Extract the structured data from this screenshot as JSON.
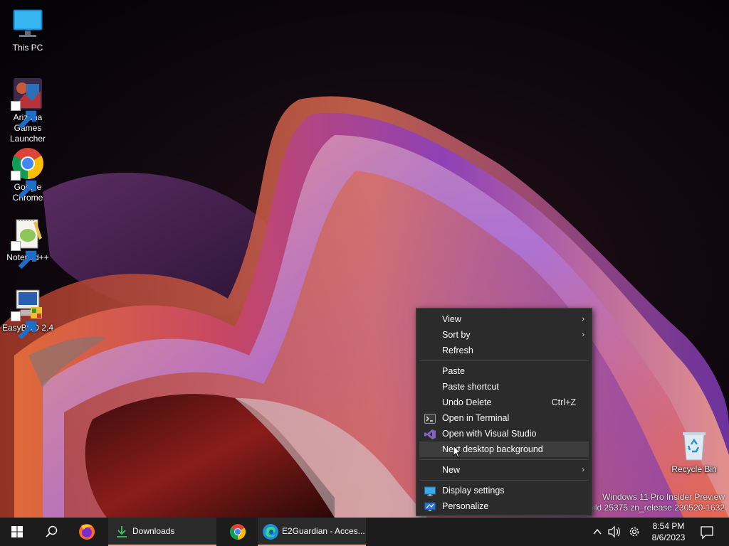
{
  "desktop": {
    "icons": [
      {
        "label": "This PC",
        "icon": "monitor-icon"
      },
      {
        "label": "Arizona Games Launcher",
        "icon": "game-launcher-icon"
      },
      {
        "label": "Google Chrome",
        "icon": "chrome-icon"
      },
      {
        "label": "Notepad++",
        "icon": "notepad-icon"
      },
      {
        "label": "EasyBCD 2.4",
        "icon": "easybcd-icon"
      },
      {
        "label": "Recycle Bin",
        "icon": "recycle-bin-icon"
      }
    ]
  },
  "watermark": {
    "line1": "Windows 11 Pro Insider Preview",
    "line2": "Build 25375.zn_release.230520-1632"
  },
  "context_menu": {
    "items": [
      {
        "label": "View",
        "submenu": true
      },
      {
        "label": "Sort by",
        "submenu": true
      },
      {
        "label": "Refresh"
      },
      {
        "label": "Paste"
      },
      {
        "label": "Paste shortcut"
      },
      {
        "label": "Undo Delete",
        "shortcut": "Ctrl+Z"
      },
      {
        "label": "Open in Terminal",
        "icon": "terminal-icon"
      },
      {
        "label": "Open with Visual Studio",
        "icon": "visual-studio-icon"
      },
      {
        "label": "Next desktop background",
        "highlighted": true
      },
      {
        "label": "New",
        "submenu": true
      },
      {
        "label": "Display settings",
        "icon": "display-icon"
      },
      {
        "label": "Personalize",
        "icon": "personalize-icon"
      }
    ],
    "submenu_glyph": "›"
  },
  "taskbar": {
    "apps": [
      {
        "title": "Downloads",
        "icon": "downloads-folder-icon"
      },
      {
        "title": "E2Guardian - Acces...",
        "icon": "edge-icon"
      }
    ],
    "tray": {
      "time": "8:54 PM",
      "date": "8/6/2023"
    }
  },
  "colors": {
    "menu_bg": "#2b2b2b",
    "taskbar_bg": "#1c1c1c",
    "active_underline": "#e3a58a"
  }
}
